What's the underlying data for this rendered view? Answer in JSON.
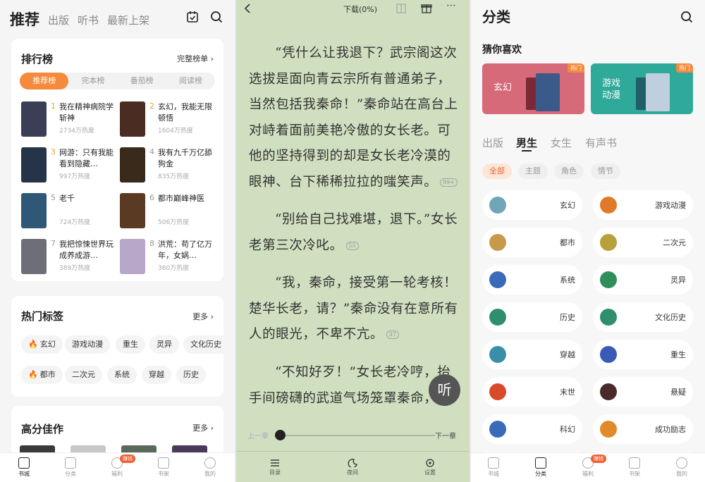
{
  "panel1": {
    "tabs": [
      "推荐",
      "出版",
      "听书",
      "最新上架"
    ],
    "ranking": {
      "title": "排行榜",
      "more": "完整榜单 ›",
      "segments": [
        "推荐榜",
        "完本榜",
        "番茄榜",
        "阅读榜"
      ],
      "items": [
        {
          "rank": "1",
          "title": "我在精神病院学斩神",
          "heat": "2734万热度",
          "cover": "#3b3f55"
        },
        {
          "rank": "2",
          "title": "玄幻，我能无限顿悟",
          "heat": "1604万热度",
          "cover": "#4a2c22"
        },
        {
          "rank": "3",
          "title": "网游：只有我能看到隐藏…",
          "heat": "997万热度",
          "cover": "#26344a"
        },
        {
          "rank": "4",
          "title": "我有九千万亿舔狗金",
          "heat": "835万热度",
          "cover": "#3a2a1c"
        },
        {
          "rank": "5",
          "title": "老千",
          "heat": "724万热度",
          "cover": "#2f5876"
        },
        {
          "rank": "6",
          "title": "都市巅峰神医",
          "heat": "506万热度",
          "cover": "#5a3a22"
        },
        {
          "rank": "7",
          "title": "我把惊悚世界玩成养成游…",
          "heat": "389万热度",
          "cover": "#6e6e78"
        },
        {
          "rank": "8",
          "title": "洪荒：苟了亿万年，女娲…",
          "heat": "360万热度",
          "cover": "#b9a7c8"
        }
      ]
    },
    "tags_card": {
      "title": "热门标签",
      "more": "更多 ›",
      "row1": [
        "玄幻",
        "游戏动漫",
        "重生",
        "灵异",
        "文化历史"
      ],
      "row2": [
        "都市",
        "二次元",
        "系统",
        "穿越",
        "历史"
      ]
    },
    "top_rated": {
      "title": "高分佳作",
      "more": "更多 ›"
    },
    "bottom_nav": [
      "书城",
      "分类",
      "福利",
      "书架",
      "我的"
    ],
    "bonus_badge": "赚钱"
  },
  "panel2": {
    "download": "下载(0%)",
    "paragraphs": [
      {
        "text": "“凭什么让我退下？武宗阁这次选拔是面向青云宗所有普通弟子，当然包括我秦命！”秦命站在高台上对峙着面前美艳冷傲的女长老。可他的坚持得到的却是女长老冷漠的眼神、台下稀稀拉拉的嗤笑声。",
        "comments": "99+"
      },
      {
        "text": "“别给自己找难堪，退下。”女长老第三次冷叱。",
        "comments": "55"
      },
      {
        "text": "“我，秦命，接受第一轮考核！楚华长老，请？”秦命没有在意所有人的眼光，不卑不亢。",
        "comments": "37"
      },
      {
        "text": "“不知好歹！”女长老冷哼，抬手间磅礴的武道气场笼罩秦命，",
        "comments": ""
      }
    ],
    "listen": "听",
    "prev_chapter": "上一章",
    "next_chapter": "下一章",
    "progress": 0.0,
    "bottom": [
      "目录",
      "夜间",
      "设置"
    ]
  },
  "panel3": {
    "title": "分类",
    "guess_title": "猜你喜欢",
    "banners": [
      {
        "label": "玄幻",
        "hot": "热门",
        "color": "#d66a78"
      },
      {
        "label": "游戏\n动漫",
        "hot": "热门",
        "color": "#2fa99a"
      }
    ],
    "gender_tabs": [
      "出版",
      "男生",
      "女生",
      "有声书"
    ],
    "chips": [
      "全部",
      "主题",
      "角色",
      "情节"
    ],
    "categories": [
      {
        "label": "玄幻",
        "color": "#6fa6b8"
      },
      {
        "label": "游戏动漫",
        "color": "#e07a2a"
      },
      {
        "label": "都市",
        "color": "#c69a4a"
      },
      {
        "label": "二次元",
        "color": "#b8a03a"
      },
      {
        "label": "系统",
        "color": "#3a6ab8"
      },
      {
        "label": "灵异",
        "color": "#2f8f5a"
      },
      {
        "label": "历史",
        "color": "#2f8f6a"
      },
      {
        "label": "文化历史",
        "color": "#2f8f6a"
      },
      {
        "label": "穿越",
        "color": "#3a8fa8"
      },
      {
        "label": "重生",
        "color": "#3a5ab8"
      },
      {
        "label": "末世",
        "color": "#d84a2a"
      },
      {
        "label": "悬疑",
        "color": "#4a2a2a"
      },
      {
        "label": "科幻",
        "color": "#3a6ab8"
      },
      {
        "label": "成功励志",
        "color": "#e08a2a"
      }
    ],
    "bottom_nav": [
      "书城",
      "分类",
      "福利",
      "书架",
      "我的"
    ],
    "bonus_badge": "赚钱"
  },
  "colors": {
    "accent": "#f58a3c",
    "reader_bg": "#cfdfbf"
  }
}
